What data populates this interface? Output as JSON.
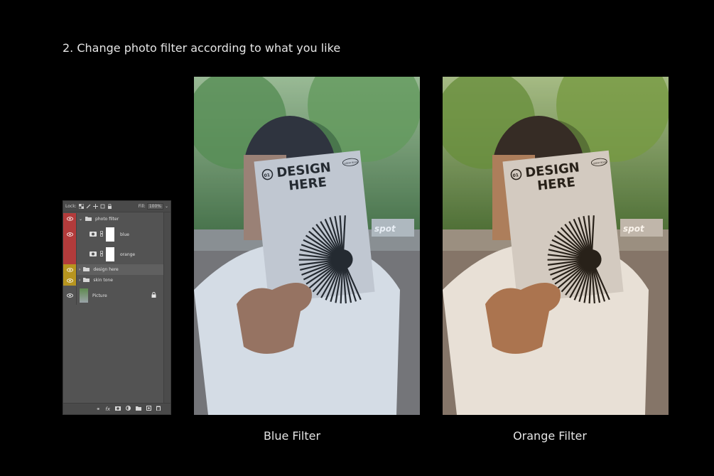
{
  "heading": "2. Change photo filter according to what you like",
  "layers_panel": {
    "lock_label": "Lock:",
    "fill_label": "Fill:",
    "fill_value": "100%",
    "layers": [
      {
        "name": "photo filter",
        "type": "group",
        "color": "#b23b3b"
      },
      {
        "name": "blue",
        "type": "adjustment",
        "color": "#b23b3b"
      },
      {
        "name": "orange",
        "type": "adjustment",
        "color": "#b23b3b"
      },
      {
        "name": "design here",
        "type": "group",
        "color": "#b7951f"
      },
      {
        "name": "skin tone",
        "type": "group",
        "color": "#b7951f"
      },
      {
        "name": "Picture",
        "type": "image",
        "locked": true
      }
    ]
  },
  "photos": [
    {
      "caption": "Blue Filter",
      "magazine_issue": "01",
      "magazine_title_1": "DESIGN",
      "magazine_title_2": "HERE",
      "magazine_badge": "GREAT BOOK",
      "sign_text": "spot",
      "tint": "#7da3c9"
    },
    {
      "caption": "Orange Filter",
      "magazine_issue": "01",
      "magazine_title_1": "DESIGN",
      "magazine_title_2": "HERE",
      "magazine_badge": "GREAT BOOK",
      "sign_text": "spot",
      "tint": "#d79a5a"
    }
  ]
}
